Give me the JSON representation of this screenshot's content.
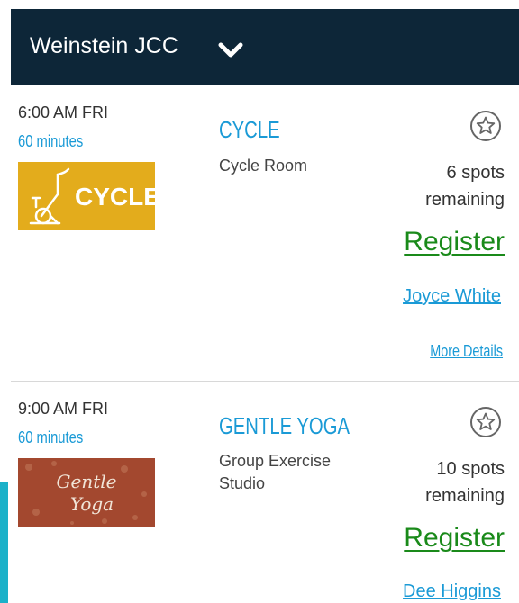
{
  "header": {
    "title": "Weinstein JCC",
    "dropdown_icon": "chevron-down-icon",
    "background_color": "#0d2638"
  },
  "sessions": [
    {
      "time": "6:00 AM FRI",
      "duration": "60 minutes",
      "thumbnail_text": "CYCLE",
      "thumbnail_icon": "exercise-bike-icon",
      "thumbnail_color": "#e3ac1c",
      "title": "CYCLE",
      "location": "Cycle Room",
      "favorite_icon": "star-outline-icon",
      "spots_line1": "6 spots",
      "spots_line2": "remaining",
      "register_label": "Register",
      "instructor": "Joyce White",
      "more_details": "More Details"
    },
    {
      "time": "9:00 AM FRI",
      "duration": "60 minutes",
      "thumbnail_text_line1": "Gentle",
      "thumbnail_text_line2": "Yoga",
      "thumbnail_color": "#a3482f",
      "title": "GENTLE YOGA",
      "location": "Group Exercise Studio",
      "favorite_icon": "star-outline-icon",
      "spots_line1": "10 spots",
      "spots_line2": "remaining",
      "register_label": "Register",
      "instructor": "Dee Higgins"
    }
  ],
  "colors": {
    "link_blue": "#1a9ad6",
    "register_green": "#1a8a1a",
    "accent_teal": "#1bb1c9"
  }
}
